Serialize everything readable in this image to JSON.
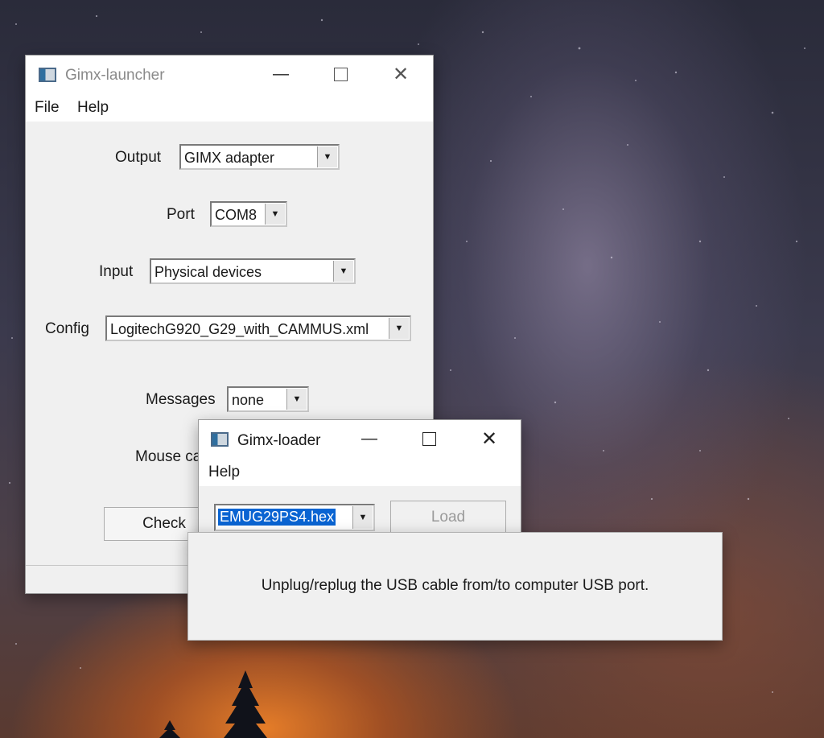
{
  "launcher": {
    "title": "Gimx-launcher",
    "menu": [
      "File",
      "Help"
    ],
    "output_label": "Output",
    "output_value": "GIMX adapter",
    "port_label": "Port",
    "port_value": "COM8",
    "input_label": "Input",
    "input_value": "Physical devices",
    "config_label": "Config",
    "config_value": "LogitechG920_G29_with_CAMMUS.xml",
    "messages_label": "Messages",
    "messages_value": "none",
    "mouse_label": "Mouse ca",
    "check_button": "Check"
  },
  "loader": {
    "title": "Gimx-loader",
    "menu": [
      "Help"
    ],
    "firmware_value": "EMUG29PS4.hex",
    "load_button": "Load"
  },
  "popup": {
    "message": "Unplug/replug the USB cable from/to computer USB port."
  },
  "icons": {
    "minimize": "minimize-icon",
    "maximize": "maximize-icon",
    "close": "close-icon",
    "dropdown": "chevron-down-icon"
  }
}
